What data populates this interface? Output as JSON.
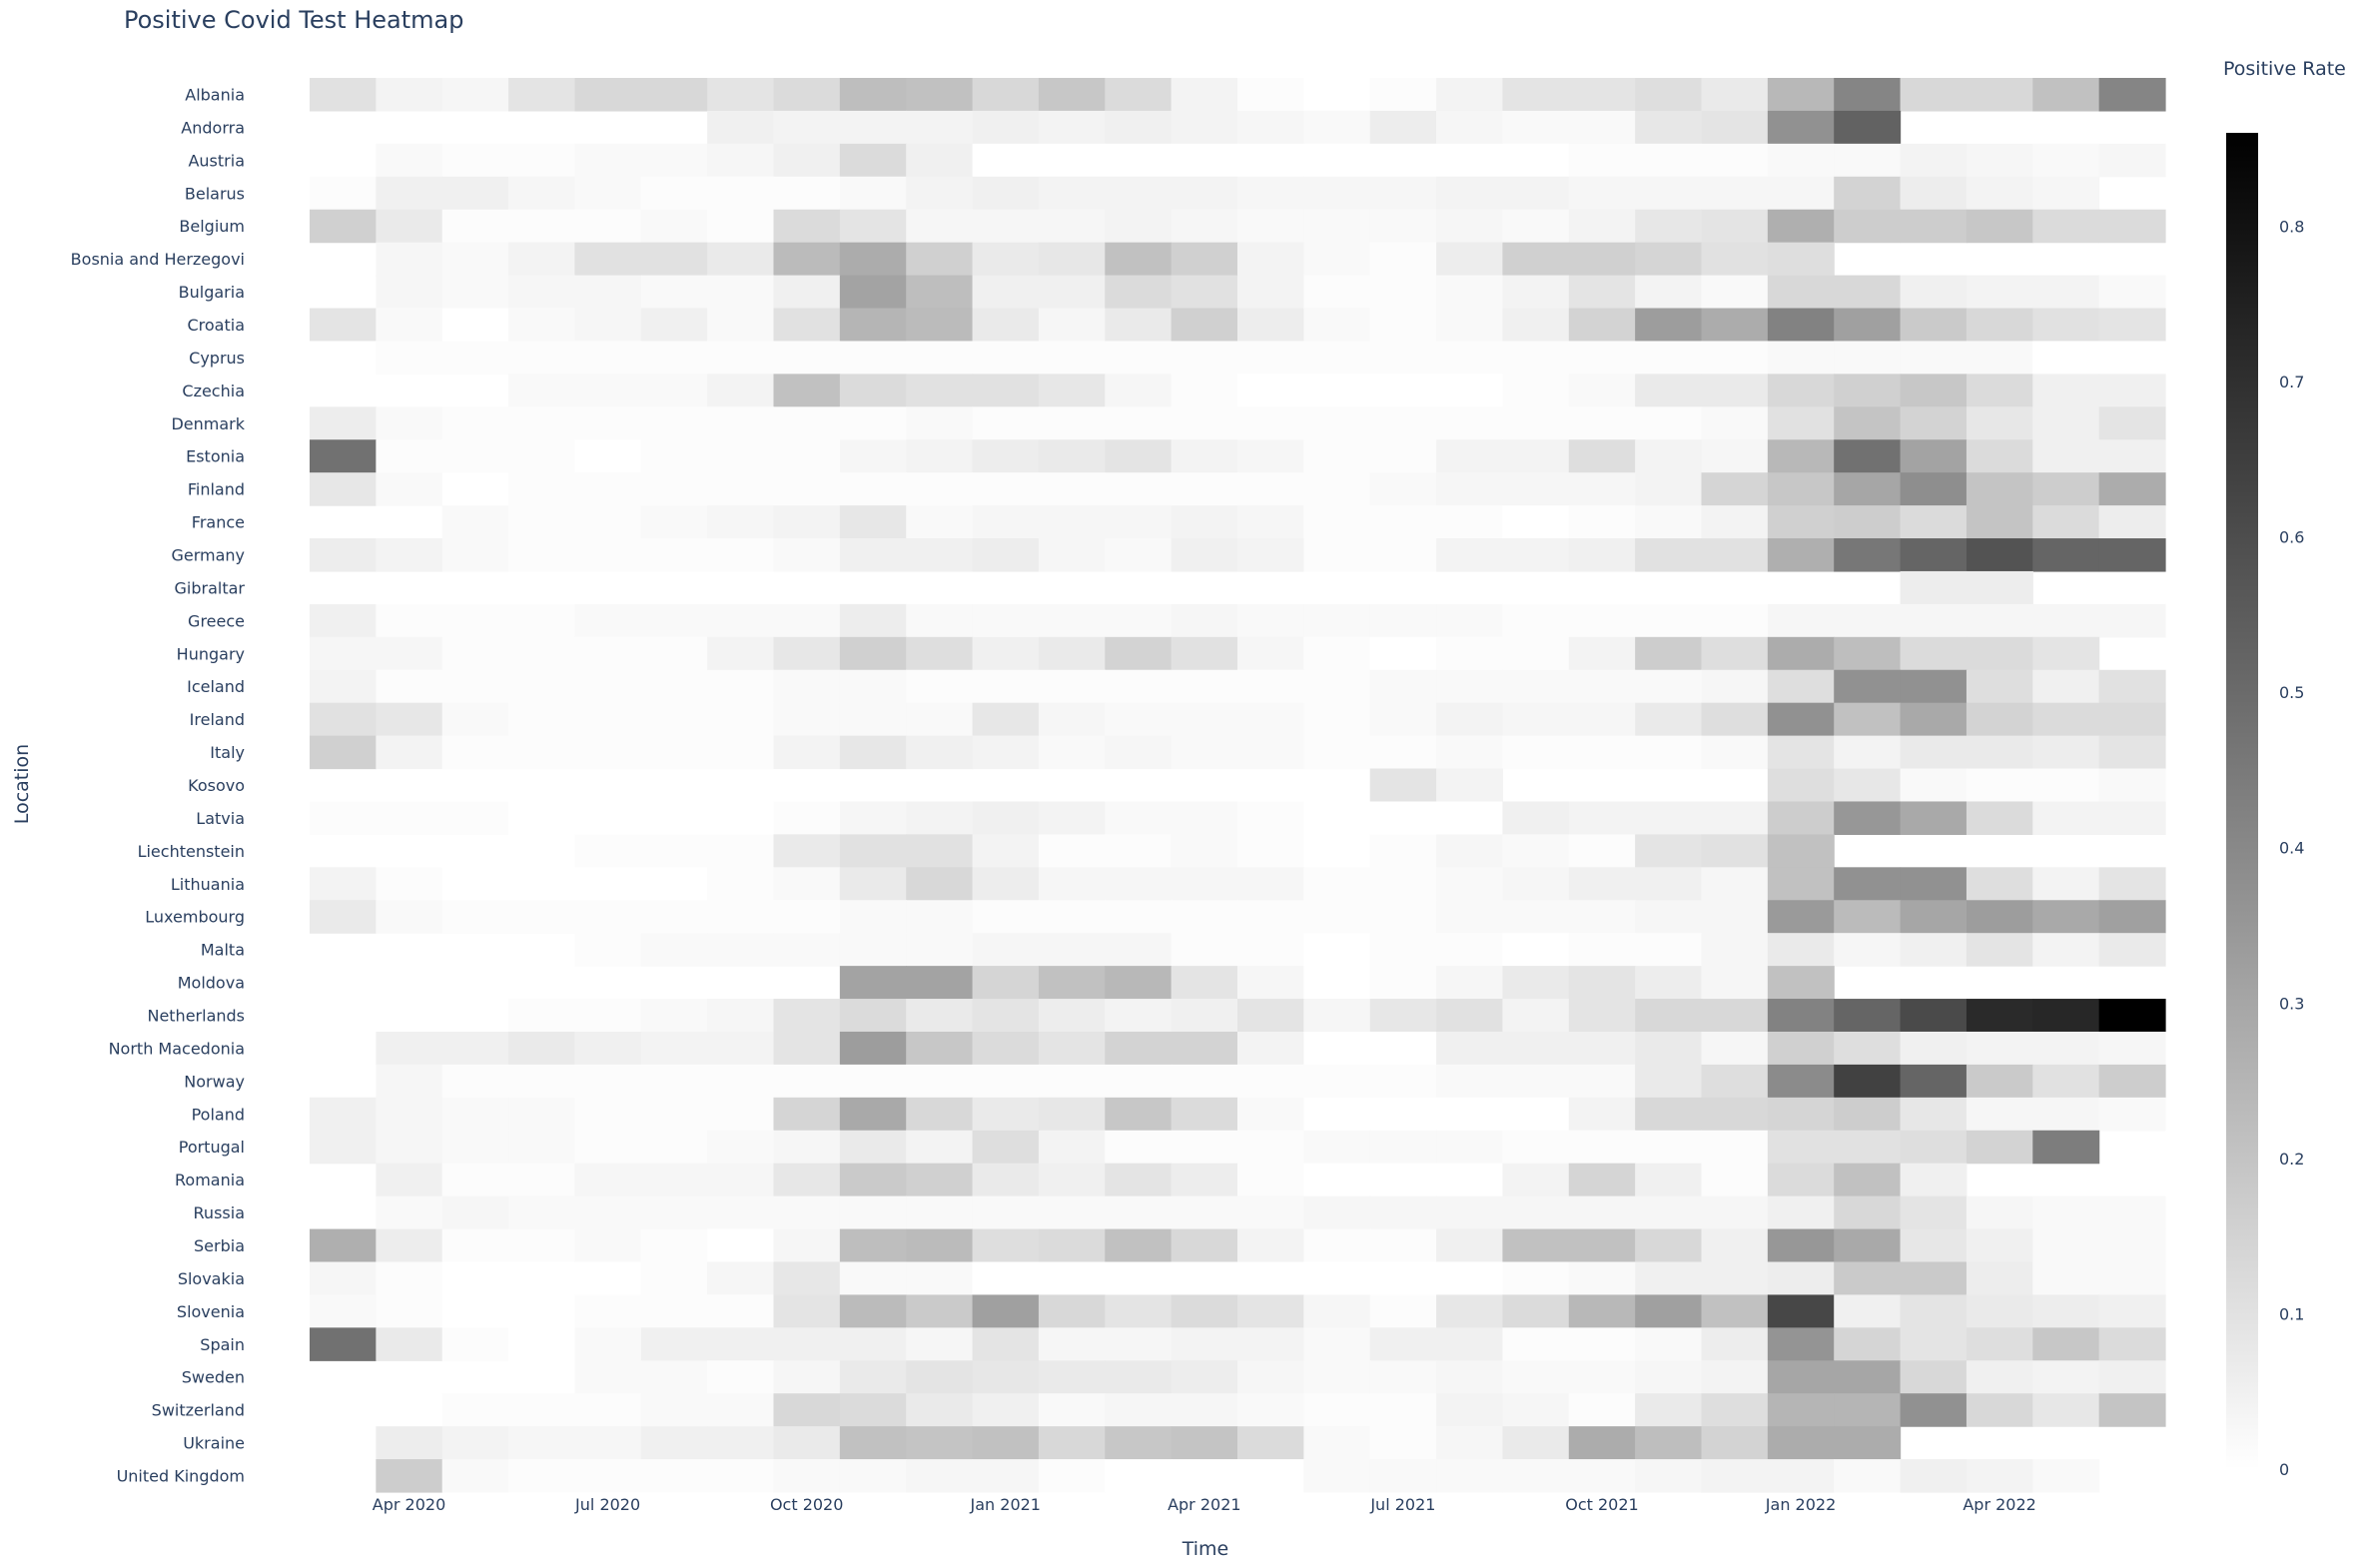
{
  "chart_data": {
    "type": "heatmap",
    "title": "Positive Covid Test Heatmap",
    "xlabel": "Time",
    "ylabel": "Location",
    "colorbar": {
      "title": "Positive Rate",
      "ticks": [
        "0",
        "0.1",
        "0.2",
        "0.3",
        "0.4",
        "0.5",
        "0.6",
        "0.7",
        "0.8"
      ],
      "zmin": 0,
      "zmax": 0.86,
      "low_color": "#ffffff",
      "high_color": "#000000"
    },
    "x": [
      "2020-03",
      "2020-04",
      "2020-05",
      "2020-06",
      "2020-07",
      "2020-08",
      "2020-09",
      "2020-10",
      "2020-11",
      "2020-12",
      "2021-01",
      "2021-02",
      "2021-03",
      "2021-04",
      "2021-05",
      "2021-06",
      "2021-07",
      "2021-08",
      "2021-09",
      "2021-10",
      "2021-11",
      "2021-12",
      "2022-01",
      "2022-02",
      "2022-03",
      "2022-04",
      "2022-05",
      "2022-06"
    ],
    "x_ticks": [
      {
        "col": 1,
        "label": "Apr 2020"
      },
      {
        "col": 4,
        "label": "Jul 2020"
      },
      {
        "col": 7,
        "label": "Oct 2020"
      },
      {
        "col": 10,
        "label": "Jan 2021"
      },
      {
        "col": 13,
        "label": "Apr 2021"
      },
      {
        "col": 16,
        "label": "Jul 2021"
      },
      {
        "col": 19,
        "label": "Oct 2021"
      },
      {
        "col": 22,
        "label": "Jan 2022"
      },
      {
        "col": 25,
        "label": "Apr 2022"
      }
    ],
    "y": [
      "Albania",
      "Andorra",
      "Austria",
      "Belarus",
      "Belgium",
      "Bosnia and Herzegovi",
      "Bulgaria",
      "Croatia",
      "Cyprus",
      "Czechia",
      "Denmark",
      "Estonia",
      "Finland",
      "France",
      "Germany",
      "Gibraltar",
      "Greece",
      "Hungary",
      "Iceland",
      "Ireland",
      "Italy",
      "Kosovo",
      "Latvia",
      "Liechtenstein",
      "Lithuania",
      "Luxembourg",
      "Malta",
      "Moldova",
      "Netherlands",
      "North Macedonia",
      "Norway",
      "Poland",
      "Portugal",
      "Romania",
      "Russia",
      "Serbia",
      "Slovakia",
      "Slovenia",
      "Spain",
      "Sweden",
      "Switzerland",
      "Ukraine",
      "United Kingdom"
    ],
    "z": [
      [
        0.1,
        0.04,
        0.03,
        0.09,
        0.13,
        0.13,
        0.09,
        0.12,
        0.22,
        0.21,
        0.13,
        0.19,
        0.12,
        0.04,
        0.01,
        0,
        0.01,
        0.04,
        0.09,
        0.09,
        0.11,
        0.07,
        0.24,
        0.41,
        0.13,
        0.13,
        0.21,
        0.41
      ],
      [
        null,
        null,
        null,
        null,
        null,
        null,
        0.05,
        0.04,
        0.04,
        0.04,
        0.05,
        0.04,
        0.05,
        0.04,
        0.03,
        0.02,
        0.06,
        0.03,
        0.02,
        0.02,
        0.08,
        0.09,
        0.37,
        0.53,
        null,
        null,
        null,
        null
      ],
      [
        null,
        0.02,
        0.01,
        0.01,
        0.02,
        0.02,
        0.03,
        0.05,
        0.12,
        0.05,
        0,
        0,
        0,
        0,
        0,
        0,
        0,
        0,
        0,
        0.01,
        0.01,
        0.01,
        0.02,
        0.02,
        0.04,
        0.03,
        0.02,
        0.03
      ],
      [
        0.01,
        0.05,
        0.05,
        0.03,
        0.02,
        0.01,
        0.01,
        0.01,
        0.02,
        0.04,
        0.05,
        0.04,
        0.04,
        0.04,
        0.03,
        0.03,
        0.03,
        0.04,
        0.04,
        0.03,
        0.03,
        0.03,
        0.03,
        0.15,
        0.06,
        0.04,
        0.03,
        null
      ],
      [
        0.16,
        0.07,
        0.01,
        0.01,
        0.01,
        0.02,
        0.01,
        0.12,
        0.09,
        0.03,
        0.03,
        0.03,
        0.04,
        0.03,
        0.02,
        0.02,
        0.02,
        0.03,
        0.02,
        0.04,
        0.08,
        0.09,
        0.27,
        0.17,
        0.17,
        0.19,
        0.12,
        0.12
      ],
      [
        null,
        0.03,
        0.02,
        0.04,
        0.1,
        0.1,
        0.07,
        0.23,
        0.28,
        0.16,
        0.07,
        0.08,
        0.21,
        0.16,
        0.04,
        0.02,
        0.01,
        0.06,
        0.16,
        0.16,
        0.14,
        0.1,
        0.11,
        null,
        null,
        null,
        null,
        null
      ],
      [
        null,
        0.03,
        0.02,
        0.03,
        0.03,
        0.02,
        0.02,
        0.05,
        0.31,
        0.22,
        0.05,
        0.05,
        0.12,
        0.1,
        0.04,
        0.01,
        0.01,
        0.02,
        0.04,
        0.09,
        0.04,
        0.02,
        0.13,
        0.13,
        0.05,
        0.04,
        0.04,
        0.02
      ],
      [
        0.09,
        0.02,
        0,
        0.02,
        0.03,
        0.05,
        0.02,
        0.1,
        0.25,
        0.23,
        0.07,
        0.03,
        0.07,
        0.16,
        0.06,
        0.02,
        0.01,
        0.02,
        0.05,
        0.15,
        0.33,
        0.28,
        0.42,
        0.32,
        0.18,
        0.13,
        0.1,
        0.09
      ],
      [
        0,
        0.01,
        0.01,
        0.01,
        0.01,
        0.01,
        0.01,
        0.01,
        0.01,
        0.01,
        0.01,
        0.01,
        0.01,
        0.01,
        0.01,
        0.01,
        0.01,
        0.01,
        0.01,
        0.01,
        0.01,
        0.01,
        0.02,
        0.02,
        0.02,
        0.02,
        0,
        0
      ],
      [
        null,
        null,
        null,
        0.02,
        0.02,
        0.02,
        0.04,
        0.21,
        0.12,
        0.1,
        0.1,
        0.08,
        0.03,
        0.01,
        0,
        0,
        0,
        0,
        0.01,
        0.02,
        0.07,
        0.07,
        0.13,
        0.16,
        0.19,
        0.12,
        0.05,
        0.05
      ],
      [
        0.06,
        0.02,
        0.01,
        0.01,
        0.01,
        0.01,
        0.01,
        0.01,
        0.01,
        0.02,
        0.01,
        0.01,
        0.01,
        0.01,
        0.01,
        0.01,
        0.01,
        0.01,
        0.01,
        0.01,
        0.01,
        0.02,
        0.1,
        0.2,
        0.15,
        0.08,
        0.05,
        0.09
      ],
      [
        0.48,
        0.01,
        0.01,
        0.01,
        0,
        0.01,
        0.01,
        0.01,
        0.03,
        0.04,
        0.06,
        0.07,
        0.09,
        0.04,
        0.03,
        0.01,
        0.01,
        0.04,
        0.04,
        0.11,
        0.04,
        0.03,
        0.24,
        0.48,
        0.31,
        0.12,
        0.05,
        0.05
      ],
      [
        0.08,
        0.02,
        0,
        0.01,
        0.01,
        0.01,
        0.01,
        0.01,
        0.01,
        0.01,
        0.01,
        0.01,
        0.01,
        0.01,
        0.01,
        0.01,
        0.02,
        0.03,
        0.03,
        0.03,
        0.04,
        0.14,
        0.19,
        0.3,
        0.38,
        0.2,
        0.17,
        0.28
      ],
      [
        null,
        null,
        0.02,
        0.01,
        0.01,
        0.02,
        0.03,
        0.04,
        0.08,
        0.02,
        0.03,
        0.03,
        0.03,
        0.04,
        0.03,
        0.01,
        0.01,
        0.01,
        0,
        0.01,
        0.02,
        0.04,
        0.16,
        0.17,
        0.12,
        0.2,
        0.12,
        0.06
      ],
      [
        0.06,
        0.04,
        0.02,
        0.01,
        0.01,
        0.01,
        0.01,
        0.02,
        0.05,
        0.05,
        0.06,
        0.03,
        0.02,
        0.05,
        0.04,
        0.01,
        0.01,
        0.04,
        0.04,
        0.05,
        0.1,
        0.1,
        0.27,
        0.46,
        0.52,
        0.58,
        0.52,
        0.52
      ],
      [
        null,
        null,
        null,
        null,
        null,
        null,
        null,
        null,
        null,
        null,
        null,
        null,
        null,
        null,
        null,
        null,
        null,
        null,
        null,
        null,
        null,
        null,
        null,
        null,
        0.06,
        0.06,
        null,
        null
      ],
      [
        0.05,
        0.01,
        0.01,
        0.01,
        0.02,
        0.02,
        0.02,
        0.02,
        0.06,
        0.02,
        0.02,
        0.02,
        0.02,
        0.03,
        0.02,
        0.02,
        0.02,
        0.02,
        0.01,
        0.01,
        0.01,
        0.01,
        0.03,
        0.03,
        0.03,
        0.03,
        0.03,
        0.03
      ],
      [
        0.03,
        0.03,
        0.01,
        0.01,
        0.01,
        0.01,
        0.04,
        0.08,
        0.16,
        0.11,
        0.05,
        0.07,
        0.15,
        0.1,
        0.03,
        0.01,
        0,
        0.01,
        0.01,
        0.04,
        0.17,
        0.11,
        0.28,
        0.22,
        0.12,
        0.12,
        0.09,
        null
      ],
      [
        0.04,
        0.01,
        0.01,
        0.01,
        0.01,
        0.01,
        0.01,
        0.02,
        0.02,
        0.01,
        0.01,
        0.01,
        0.01,
        0.01,
        0.01,
        0.01,
        0.02,
        0.02,
        0.02,
        0.02,
        0.02,
        0.03,
        0.11,
        0.37,
        0.37,
        0.11,
        0.05,
        0.1
      ],
      [
        0.1,
        0.08,
        0.02,
        0.01,
        0.01,
        0.01,
        0.01,
        0.02,
        0.02,
        0.02,
        0.08,
        0.03,
        0.02,
        0.02,
        0.02,
        0.01,
        0.02,
        0.04,
        0.03,
        0.03,
        0.07,
        0.11,
        0.37,
        0.21,
        0.29,
        0.15,
        0.12,
        0.12
      ],
      [
        0.16,
        0.04,
        0.01,
        0.01,
        0.01,
        0.01,
        0.01,
        0.04,
        0.08,
        0.05,
        0.04,
        0.02,
        0.03,
        0.02,
        0.02,
        0.01,
        0.01,
        0.02,
        0.01,
        0.01,
        0.01,
        0.02,
        0.09,
        0.04,
        0.07,
        0.07,
        0.06,
        0.09
      ],
      [
        null,
        null,
        null,
        null,
        null,
        null,
        null,
        null,
        null,
        null,
        null,
        null,
        null,
        null,
        null,
        null,
        0.09,
        0.04,
        null,
        null,
        null,
        null,
        0.11,
        0.08,
        0.02,
        0.01,
        0.01,
        0.02
      ],
      [
        0.01,
        0.01,
        0.01,
        0,
        0,
        0,
        0,
        0.01,
        0.03,
        0.04,
        0.05,
        0.04,
        0.02,
        0.02,
        0.01,
        0,
        0,
        0,
        0.05,
        0.04,
        0.04,
        0.04,
        0.17,
        0.35,
        0.29,
        0.12,
        0.04,
        0.04
      ],
      [
        null,
        null,
        null,
        null,
        0.01,
        0.01,
        0.01,
        0.07,
        0.1,
        0.1,
        0.04,
        0.01,
        0.01,
        0.02,
        0.01,
        0,
        0.01,
        0.03,
        0.02,
        0.01,
        0.09,
        0.1,
        0.21,
        null,
        null,
        null,
        null,
        null
      ],
      [
        0.04,
        0.01,
        0,
        0,
        0,
        0,
        0.01,
        0.02,
        0.07,
        0.13,
        0.06,
        0.03,
        0.03,
        0.03,
        0.03,
        0.01,
        0.01,
        0.02,
        0.03,
        0.05,
        0.05,
        0.03,
        0.21,
        0.37,
        0.37,
        0.11,
        0.04,
        0.09
      ],
      [
        0.07,
        0.02,
        0.01,
        0.01,
        0.01,
        0.01,
        0.01,
        0.01,
        0.02,
        0.02,
        0.01,
        0.01,
        0.01,
        0.01,
        0.01,
        0.01,
        0.01,
        0.02,
        0.02,
        0.02,
        0.03,
        0.03,
        0.34,
        0.23,
        0.3,
        0.33,
        0.29,
        0.32
      ],
      [
        null,
        null,
        null,
        null,
        0.01,
        0.02,
        0.02,
        0.02,
        0.02,
        0.02,
        0.03,
        0.03,
        0.03,
        0.01,
        0.01,
        0,
        0.01,
        0.01,
        0,
        0.01,
        0.01,
        0.03,
        0.07,
        0.03,
        0.05,
        0.09,
        0.04,
        0.07
      ],
      [
        null,
        null,
        null,
        null,
        null,
        null,
        null,
        null,
        0.31,
        0.31,
        0.14,
        0.21,
        0.24,
        0.09,
        0.03,
        0,
        0.01,
        0.03,
        0.07,
        0.09,
        0.06,
        0.03,
        0.21,
        null,
        null,
        null,
        null,
        null
      ],
      [
        null,
        null,
        null,
        0.01,
        0.01,
        0.02,
        0.03,
        0.09,
        0.12,
        0.07,
        0.09,
        0.06,
        0.04,
        0.05,
        0.09,
        0.03,
        0.08,
        0.1,
        0.04,
        0.09,
        0.13,
        0.13,
        0.42,
        0.52,
        0.61,
        0.72,
        0.73,
        0.86
      ],
      [
        null,
        0.05,
        0.05,
        0.07,
        0.05,
        0.04,
        0.04,
        0.09,
        0.33,
        0.19,
        0.12,
        0.09,
        0.15,
        0.15,
        0.04,
        0,
        0,
        0.05,
        0.05,
        0.05,
        0.07,
        0.03,
        0.16,
        0.11,
        0.05,
        0.04,
        0.04,
        0.03
      ],
      [
        null,
        0.03,
        0.01,
        0.01,
        0.01,
        0.01,
        0.01,
        0.01,
        0.01,
        0.01,
        0.01,
        0.01,
        0.01,
        0.01,
        0.01,
        0.01,
        0.01,
        0.02,
        0.02,
        0.02,
        0.07,
        0.11,
        0.39,
        0.64,
        0.52,
        0.18,
        0.1,
        0.17
      ],
      [
        0.05,
        0.03,
        0.02,
        0.02,
        0.01,
        0.01,
        0.01,
        0.14,
        0.29,
        0.13,
        0.07,
        0.08,
        0.19,
        0.12,
        0.02,
        0,
        0,
        0,
        0,
        0.04,
        0.13,
        0.13,
        0.14,
        0.17,
        0.08,
        0.03,
        0.03,
        0.02
      ],
      [
        0.05,
        0.03,
        0.02,
        0.02,
        0.01,
        0.01,
        0.02,
        0.03,
        0.07,
        0.04,
        0.11,
        0.04,
        0.01,
        0.01,
        0.01,
        0.02,
        0.02,
        0.02,
        0.01,
        0.01,
        0.01,
        0.01,
        0.1,
        0.1,
        0.11,
        0.15,
        0.44,
        null
      ],
      [
        null,
        0.05,
        0.01,
        0.01,
        0.03,
        0.03,
        0.03,
        0.08,
        0.18,
        0.16,
        0.07,
        0.05,
        0.09,
        0.06,
        0.01,
        0,
        0,
        0,
        0.04,
        0.14,
        0.05,
        0.01,
        0.12,
        0.21,
        0.05,
        null,
        null,
        null
      ],
      [
        null,
        0.02,
        0.03,
        0.02,
        0.02,
        0.02,
        0.02,
        0.02,
        0.02,
        0.02,
        0.02,
        0.02,
        0.02,
        0.02,
        0.02,
        0.03,
        0.03,
        0.03,
        0.03,
        0.03,
        0.03,
        0.03,
        0.05,
        0.13,
        0.09,
        0.03,
        0.02,
        0.02
      ],
      [
        0.27,
        0.06,
        0.01,
        0.01,
        0.02,
        0.01,
        0,
        0.03,
        0.22,
        0.23,
        0.11,
        0.12,
        0.21,
        0.13,
        0.04,
        0.01,
        0.01,
        0.05,
        0.21,
        0.21,
        0.13,
        0.05,
        0.35,
        0.29,
        0.08,
        0.05,
        0.02,
        0.02
      ],
      [
        0.03,
        0.01,
        0,
        0,
        0,
        0.01,
        0.03,
        0.08,
        0.02,
        0.02,
        0,
        0,
        0,
        0,
        0,
        0,
        0,
        0,
        0.01,
        0.02,
        0.05,
        0.05,
        0.06,
        0.18,
        0.18,
        0.06,
        0.02,
        0.02
      ],
      [
        0.02,
        0.01,
        0,
        0,
        0.01,
        0.01,
        0.01,
        0.09,
        0.23,
        0.18,
        0.32,
        0.13,
        0.09,
        0.12,
        0.09,
        0.03,
        0.01,
        0.08,
        0.12,
        0.24,
        0.32,
        0.21,
        0.62,
        0.05,
        0.09,
        0.07,
        0.06,
        0.05
      ],
      [
        0.48,
        0.07,
        0.01,
        0,
        0.02,
        0.05,
        0.05,
        0.05,
        0.05,
        0.03,
        0.09,
        0.03,
        0.03,
        0.04,
        0.04,
        0.02,
        0.05,
        0.05,
        0.01,
        0.01,
        0.02,
        0.06,
        0.36,
        0.14,
        0.09,
        0.11,
        0.19,
        0.12
      ],
      [
        null,
        null,
        null,
        null,
        0.02,
        0.02,
        0.01,
        0.03,
        0.07,
        0.09,
        0.08,
        0.07,
        0.07,
        0.06,
        0.03,
        0.02,
        0.02,
        0.03,
        0.02,
        0.02,
        0.03,
        0.04,
        0.3,
        0.3,
        0.13,
        0.05,
        0.04,
        0.05
      ],
      [
        null,
        null,
        0.01,
        0.01,
        0.01,
        0.02,
        0.02,
        0.13,
        0.12,
        0.07,
        0.05,
        0.02,
        0.03,
        0.03,
        0.02,
        0.01,
        0.01,
        0.04,
        0.03,
        0.01,
        0.07,
        0.11,
        0.25,
        0.25,
        0.37,
        0.13,
        0.08,
        0.2
      ],
      [
        null,
        0.06,
        0.04,
        0.03,
        0.03,
        0.05,
        0.05,
        0.07,
        0.21,
        0.2,
        0.21,
        0.13,
        0.19,
        0.2,
        0.12,
        0.02,
        0.01,
        0.03,
        0.07,
        0.28,
        0.22,
        0.15,
        0.28,
        0.28,
        null,
        null,
        null,
        null
      ],
      [
        null,
        0.17,
        0.02,
        0.01,
        0.01,
        0.01,
        0.01,
        0.02,
        0.02,
        0.03,
        0.03,
        0.01,
        0,
        0,
        0,
        0.02,
        0.02,
        0.02,
        0.02,
        0.02,
        0.03,
        0.04,
        0.04,
        0.02,
        0.05,
        0.04,
        0.02,
        null
      ]
    ]
  }
}
